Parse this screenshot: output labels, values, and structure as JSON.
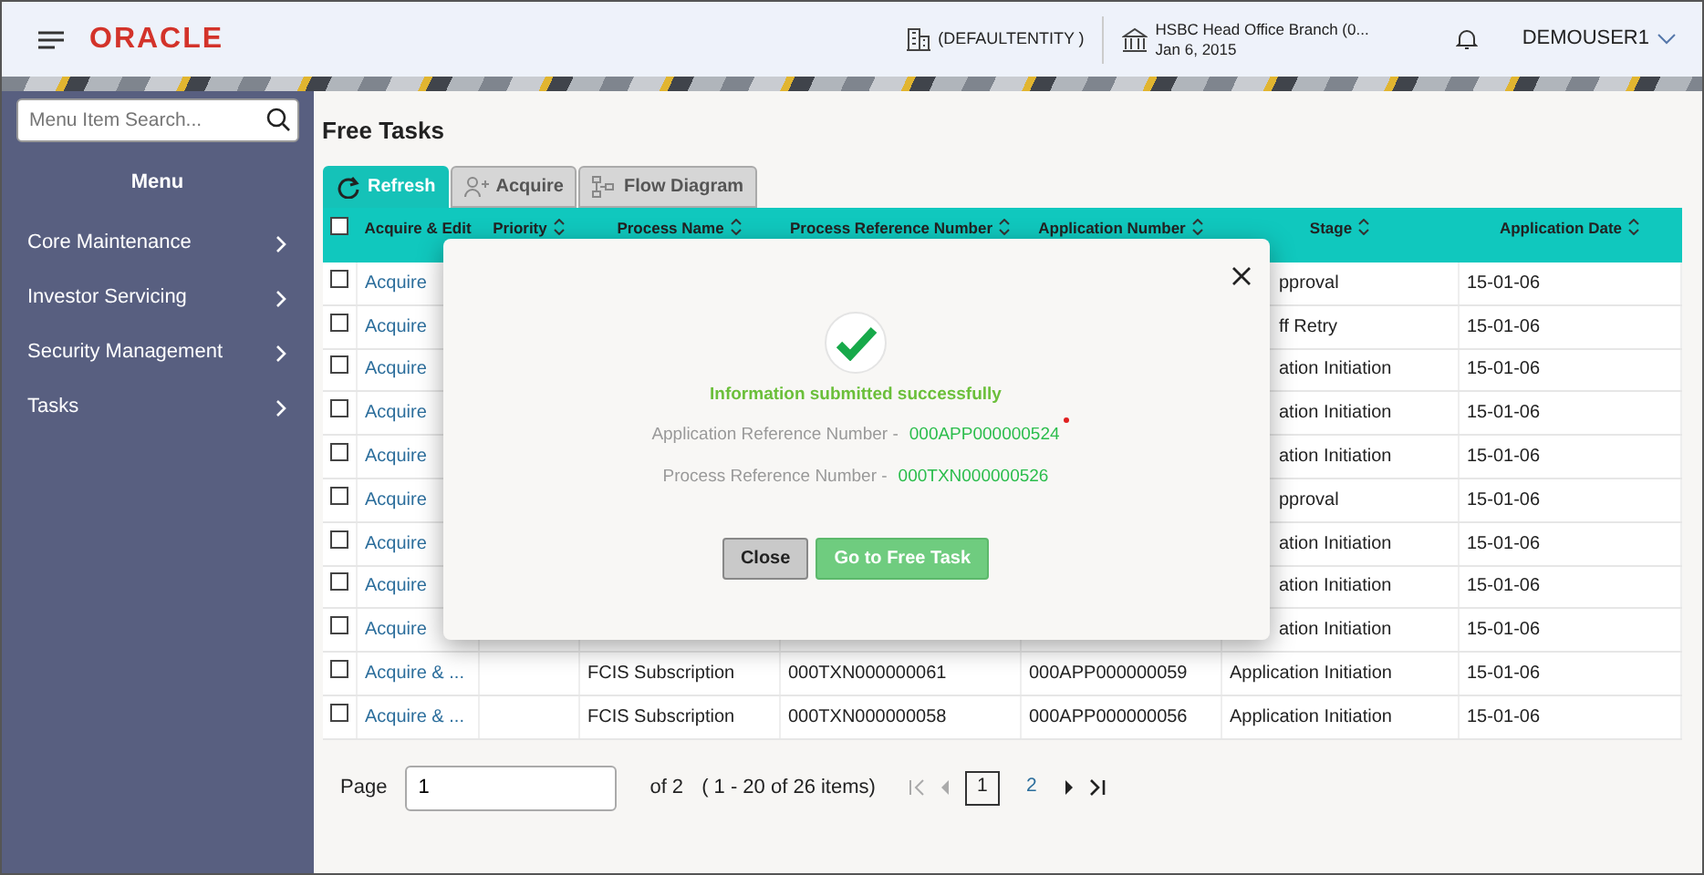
{
  "header": {
    "brand": "ORACLE",
    "entity": "(DEFAULTENTITY )",
    "branch": "HSBC Head Office Branch (0...",
    "date": "Jan 6, 2015",
    "user": "DEMOUSER1"
  },
  "sidebar": {
    "search_placeholder": "Menu Item Search...",
    "title": "Menu",
    "items": [
      {
        "label": "Core Maintenance"
      },
      {
        "label": "Investor Servicing"
      },
      {
        "label": "Security Management"
      },
      {
        "label": "Tasks"
      }
    ]
  },
  "page_title": "Free Tasks",
  "toolbar": [
    {
      "label": "Refresh",
      "kind": "refresh",
      "disabled": false
    },
    {
      "label": "Acquire",
      "kind": "acquire",
      "disabled": true
    },
    {
      "label": "Flow Diagram",
      "kind": "flow",
      "disabled": true
    }
  ],
  "table": {
    "select_all_checked": false,
    "columns": [
      "Acquire & Edit",
      "Priority",
      "Process Name",
      "Process Reference Number",
      "Application Number",
      "Stage",
      "Application Date"
    ],
    "rows": [
      {
        "kind": "covered",
        "checked": false,
        "action": "Acquire",
        "stage": "pproval",
        "date": "15-01-06"
      },
      {
        "kind": "covered",
        "checked": false,
        "action": "Acquire",
        "stage": "ff Retry",
        "date": "15-01-06"
      },
      {
        "kind": "covered",
        "checked": false,
        "action": "Acquire",
        "stage": "ation Initiation",
        "date": "15-01-06"
      },
      {
        "kind": "covered",
        "checked": false,
        "action": "Acquire",
        "stage": "ation Initiation",
        "date": "15-01-06"
      },
      {
        "kind": "covered",
        "checked": false,
        "action": "Acquire",
        "stage": "ation Initiation",
        "date": "15-01-06"
      },
      {
        "kind": "covered",
        "checked": false,
        "action": "Acquire",
        "stage": "pproval",
        "date": "15-01-06"
      },
      {
        "kind": "covered",
        "checked": false,
        "action": "Acquire",
        "stage": "ation Initiation",
        "date": "15-01-06"
      },
      {
        "kind": "covered",
        "checked": false,
        "action": "Acquire",
        "stage": "ation Initiation",
        "date": "15-01-06"
      },
      {
        "kind": "covered",
        "checked": false,
        "action": "Acquire",
        "stage": "ation Initiation",
        "date": "15-01-06"
      },
      {
        "kind": "full",
        "checked": false,
        "action": "Acquire & ...",
        "process_name": "FCIS Subscription",
        "process_ref": "000TXN000000061",
        "app_number": "000APP000000059",
        "stage": "Application Initiation",
        "date": "15-01-06"
      },
      {
        "kind": "full",
        "checked": false,
        "action": "Acquire & ...",
        "process_name": "FCIS Subscription",
        "process_ref": "000TXN000000058",
        "app_number": "000APP000000056",
        "stage": "Application Initiation",
        "date": "15-01-06"
      }
    ]
  },
  "pagination": {
    "label": "Page",
    "value": "1",
    "of": "of 2",
    "range": "( 1 - 20 of 26 items)",
    "pages": [
      {
        "label": "1",
        "selected": true
      },
      {
        "label": "2",
        "selected": false
      }
    ]
  },
  "dialog": {
    "message": "Information submitted successfully",
    "details": [
      {
        "label": "Application Reference Number -",
        "value": "000APP000000524"
      },
      {
        "label": "Process Reference Number -",
        "value": "000TXN000000526"
      }
    ],
    "buttons": [
      {
        "label": "Close",
        "kind": "secondary"
      },
      {
        "label": "Go to Free Task",
        "kind": "primary"
      }
    ]
  }
}
